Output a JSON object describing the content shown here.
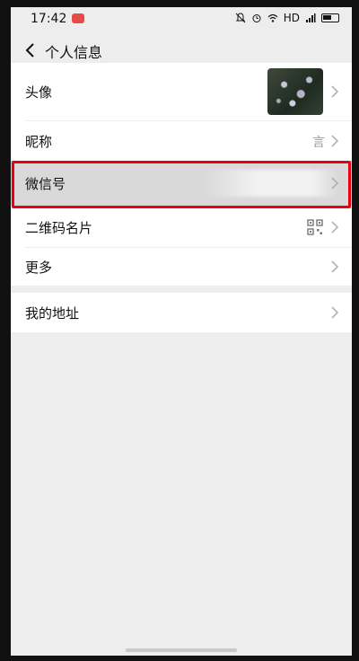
{
  "status_bar": {
    "time": "17:42",
    "network": "HD"
  },
  "header": {
    "title": "个人信息"
  },
  "rows": {
    "avatar": {
      "label": "头像"
    },
    "nickname": {
      "label": "昵称",
      "value": "言"
    },
    "wechat_id": {
      "label": "微信号"
    },
    "qr_card": {
      "label": "二维码名片"
    },
    "more": {
      "label": "更多"
    },
    "address": {
      "label": "我的地址"
    }
  },
  "colors": {
    "highlight": "#e60012",
    "background": "#ededed"
  }
}
